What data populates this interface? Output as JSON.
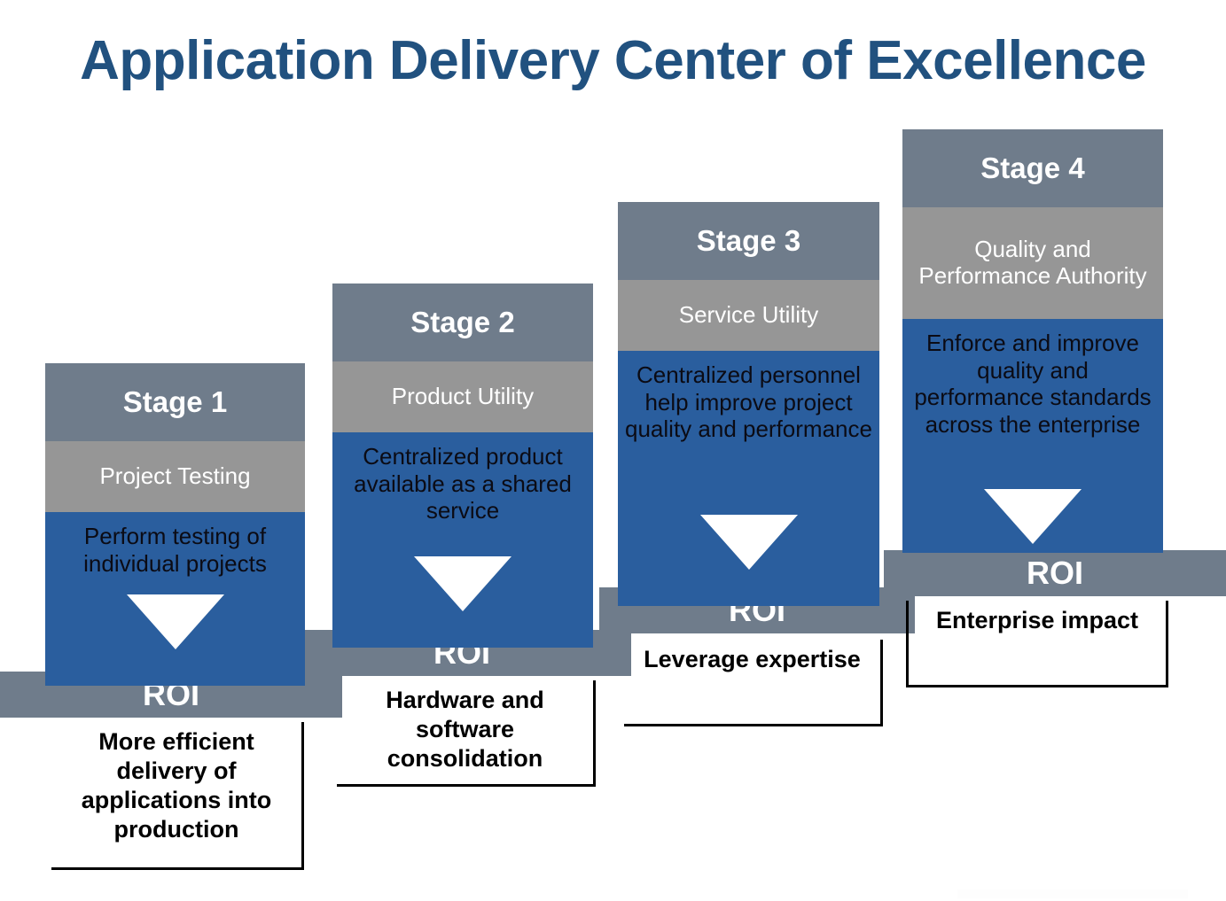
{
  "title": "Application Delivery Center of Excellence",
  "colors": {
    "title_blue": "#21517F",
    "header_slate": "#6F7C8B",
    "band_gray": "#969696",
    "body_blue": "#2A5E9E",
    "arrow_white": "#FFFFFF",
    "callout_border": "#000000",
    "page_background": "#FFFFFF"
  },
  "roi_label": "ROI",
  "stages": [
    {
      "header": "Stage 1",
      "subtitle": "Project Testing",
      "body": "Perform testing of individual projects",
      "roi": "ROI",
      "callout": "More efficient delivery of applications into production"
    },
    {
      "header": "Stage 2",
      "subtitle": "Product Utility",
      "body": "Centralized product available as a shared service",
      "roi": "ROI",
      "callout": "Hardware and software consolidation"
    },
    {
      "header": "Stage 3",
      "subtitle": "Service Utility",
      "body": "Centralized personnel help improve project quality and performance",
      "roi": "ROI",
      "callout": "Leverage expertise"
    },
    {
      "header": "Stage 4",
      "subtitle": "Quality and Performance Authority",
      "body": "Enforce and improve quality and performance standards across the enterprise",
      "roi": "ROI",
      "callout": "Enterprise impact"
    }
  ]
}
